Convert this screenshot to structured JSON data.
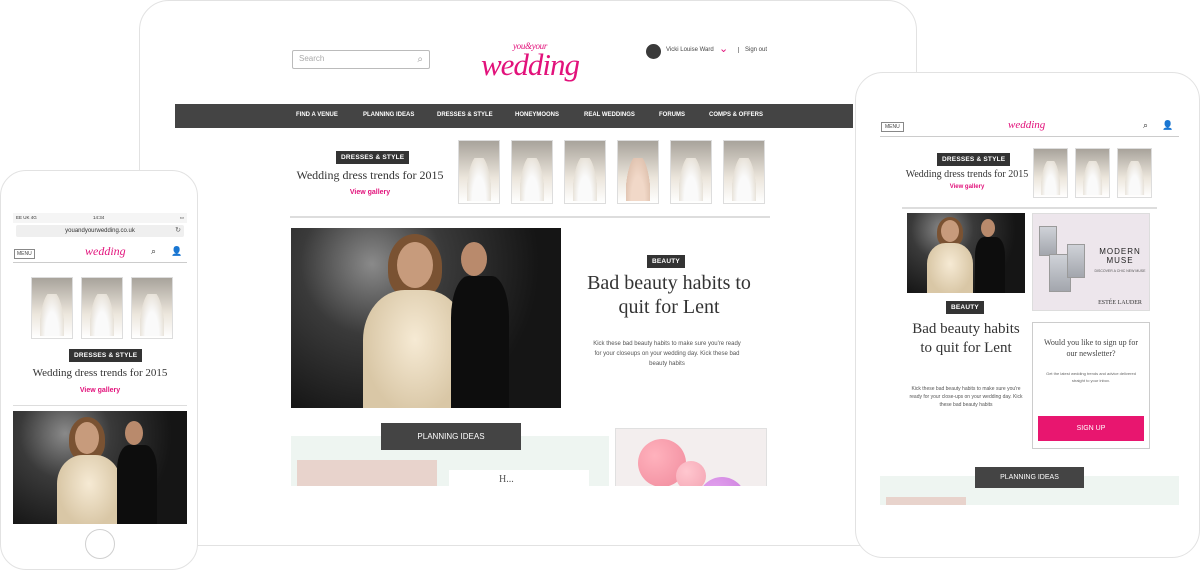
{
  "brand": {
    "logo_small": "you&your",
    "logo_big": "wedding",
    "logo_compact": "wedding",
    "accent_color": "#e2127b"
  },
  "desktop": {
    "search_placeholder": "Search",
    "user_name": "Vicki Louise Ward",
    "sign_out": "Sign out",
    "nav": [
      "FIND A VENUE",
      "PLANNING IDEAS",
      "DRESSES & STYLE",
      "HONEYMOONS",
      "REAL WEDDINGS",
      "FORUMS",
      "COMPS & OFFERS"
    ],
    "gallery_tag": "DRESSES & STYLE",
    "gallery_title": "Wedding dress trends for 2015",
    "gallery_link": "View gallery",
    "feature_tag": "BEAUTY",
    "feature_headline": "Bad beauty habits to quit for Lent",
    "feature_body": "Kick these bad beauty habits to make sure you're ready for your closeups on your wedding day. Kick these bad beauty habits",
    "planning_label": "PLANNING IDEAS",
    "planning_teaser": "H..."
  },
  "tablet": {
    "menu": "MENU",
    "gallery_tag": "DRESSES & STYLE",
    "gallery_title": "Wedding dress trends for 2015",
    "gallery_link": "View gallery",
    "feature_tag": "BEAUTY",
    "feature_headline": "Bad beauty habits to quit for Lent",
    "feature_body": "Kick these bad beauty habits to make sure you're ready for your close-ups on your wedding day. Kick these bad beauty habits",
    "ad_title": "MODERN MUSE",
    "ad_sub": "DISCOVER A CHIC NEW MUSE",
    "ad_brand": "ESTÉE LAUDER",
    "newsletter_title": "Would you like to sign up for our newsletter?",
    "newsletter_body": "Get the latest wedding trends and advice delivered straight to your inbox.",
    "signup": "SIGN UP",
    "planning_label": "PLANNING IDEAS"
  },
  "phone": {
    "carrier": "EE UK  4G",
    "time": "14:34",
    "url": "youandyourwedding.co.uk",
    "menu": "MENU",
    "gallery_tag": "DRESSES & STYLE",
    "gallery_title": "Wedding dress trends for 2015",
    "gallery_link": "View gallery"
  }
}
